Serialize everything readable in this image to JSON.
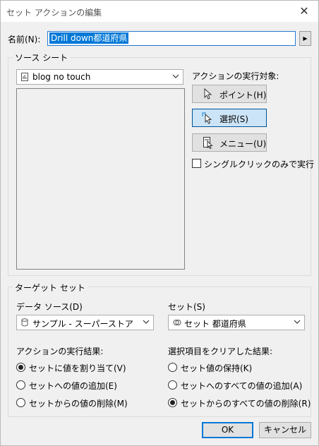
{
  "window": {
    "title": "セット アクションの編集",
    "close_glyph": "✕"
  },
  "name": {
    "label": "名前(N):",
    "value": "Drill down都道府県"
  },
  "source_sheets": {
    "group_label": "ソース シート",
    "sheet_value": "blog no touch"
  },
  "run_target": {
    "label": "アクションの実行対象:",
    "buttons": [
      {
        "label": "ポイント(H)",
        "icon": "pointer-icon",
        "selected": false
      },
      {
        "label": "選択(S)",
        "icon": "select-icon",
        "selected": true
      },
      {
        "label": "メニュー(U)",
        "icon": "menu-icon",
        "selected": false
      }
    ],
    "single_click_label": "シングルクリックのみで実行",
    "single_click_checked": false
  },
  "target_set": {
    "group_label": "ターゲット セット",
    "datasource_label": "データ ソース(D)",
    "datasource_value": "サンプル - スーパーストア",
    "set_label": "セット(S)",
    "set_value": "セット 都道府県"
  },
  "run_result": {
    "label": "アクションの実行結果:",
    "options": [
      {
        "label": "セットに値を割り当て(V)",
        "checked": true
      },
      {
        "label": "セットへの値の追加(E)",
        "checked": false
      },
      {
        "label": "セットからの値の削除(M)",
        "checked": false
      }
    ]
  },
  "clear_result": {
    "label": "選択項目をクリアした結果:",
    "options": [
      {
        "label": "セット値の保持(K)",
        "checked": false
      },
      {
        "label": "セットへのすべての値の追加(A)",
        "checked": false
      },
      {
        "label": "セットからのすべての値の削除(R)",
        "checked": true
      }
    ]
  },
  "footer": {
    "ok": "OK",
    "cancel": "キャンセル"
  },
  "colors": {
    "accent": "#0078d7",
    "selected_button_bg": "#cce4f7",
    "dialog_bg": "#f0f0f0"
  }
}
